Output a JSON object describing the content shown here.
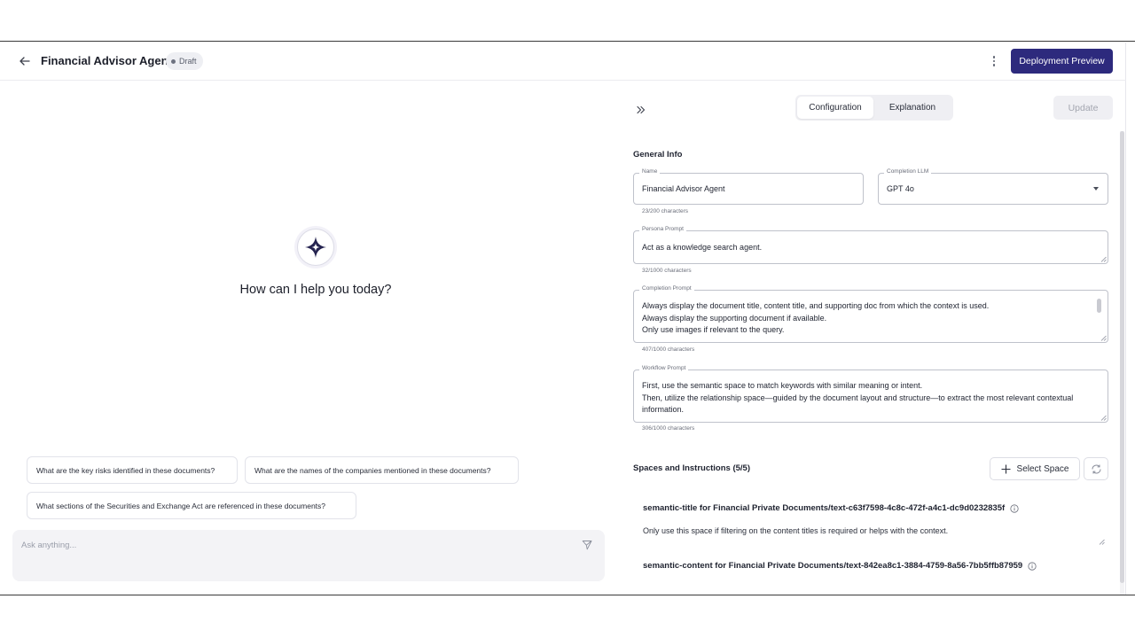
{
  "header": {
    "title": "Financial Advisor Agent",
    "status_badge": "Draft",
    "deploy_label": "Deployment Preview"
  },
  "chat": {
    "greeting": "How can I help you today?",
    "suggestions": [
      "What are the key risks identified in these documents?",
      "What are the names of the companies mentioned in these documents?",
      "What sections of the Securities and Exchange Act are referenced in these documents?"
    ],
    "input_placeholder": "Ask anything..."
  },
  "config": {
    "tabs": [
      "Configuration",
      "Explanation"
    ],
    "active_tab": "Configuration",
    "update_label": "Update",
    "general_info_title": "General Info",
    "name": {
      "label": "Name",
      "value": "Financial Advisor Agent",
      "count": "23/200 characters"
    },
    "completion_llm": {
      "label": "Completion LLM",
      "value": "GPT 4o"
    },
    "persona_prompt": {
      "label": "Persona Prompt",
      "value": "Act as a knowledge search agent.",
      "count": "32/1000 characters"
    },
    "completion_prompt": {
      "label": "Completion Prompt",
      "value": "Always display the document title, content title, and supporting doc from which the context is used.\nAlways display the supporting document if available.\nOnly use images if relevant to the query.",
      "count": "407/1000 characters"
    },
    "workflow_prompt": {
      "label": "Workflow Prompt",
      "value": "First, use the semantic space to match keywords with similar meaning or intent.\nThen, utilize the relationship space—guided by the document layout and structure—to extract the most relevant contextual information.",
      "count": "306/1000 characters"
    },
    "spaces_title": "Spaces and Instructions (5/5)",
    "select_space_label": "Select Space",
    "spaces": [
      {
        "name": "semantic-title for Financial Private Documents/text-c63f7598-4c8c-472f-a4c1-dc9d0232835f",
        "instruction": "Only use this space if filtering on the content titles is required or helps with the context."
      },
      {
        "name": "semantic-content for Financial Private Documents/text-842ea8c1-3884-4759-8a56-7bb5ffb87959"
      }
    ]
  },
  "colors": {
    "primary": "#2d2a7d",
    "badge_bg": "#eeeff3",
    "panel_bg": "#f3f3f6"
  }
}
